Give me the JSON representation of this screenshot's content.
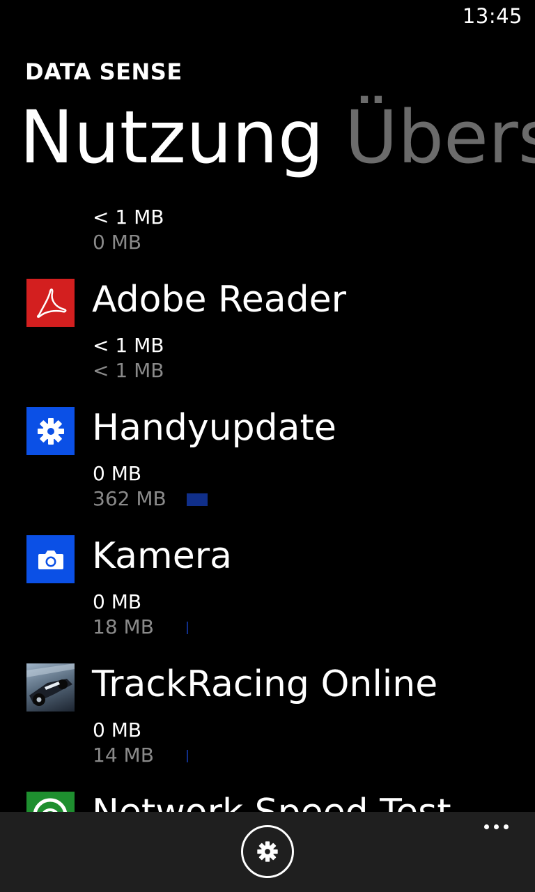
{
  "status_bar": {
    "time": "13:45"
  },
  "app": {
    "title": "DATA SENSE"
  },
  "pivot": {
    "active": "Nutzung",
    "next": "Übers"
  },
  "apps": [
    {
      "name": "",
      "icon": "app-icon",
      "cellular": "< 1 MB",
      "wifi": "0 MB",
      "bar_fraction": 0
    },
    {
      "name": "Adobe Reader",
      "icon": "adobe-reader-icon",
      "tile_color": "#d31f1f",
      "cellular": "< 1 MB",
      "wifi": "< 1 MB",
      "bar_fraction": 0
    },
    {
      "name": "Handyupdate",
      "icon": "gear-icon",
      "tile_color": "#0b50e6",
      "cellular": "0 MB",
      "wifi": "362 MB",
      "bar_fraction": 0.075
    },
    {
      "name": "Kamera",
      "icon": "camera-icon",
      "tile_color": "#0b50e6",
      "cellular": "0 MB",
      "wifi": "18 MB",
      "bar_fraction": 0.005
    },
    {
      "name": "TrackRacing Online",
      "icon": "racing-car-icon",
      "cellular": "0 MB",
      "wifi": "14 MB",
      "bar_fraction": 0.005
    },
    {
      "name": "Network Speed Test",
      "icon": "speedometer-icon",
      "tile_color": "#1e8f2f"
    }
  ],
  "app_bar": {
    "settings_icon": "gear-icon",
    "more_icon": "more-dots-icon"
  },
  "colors": {
    "accent": "#0b50e6",
    "bar": "#102f8a",
    "background": "#000000",
    "app_bar": "#1f1f1f"
  }
}
